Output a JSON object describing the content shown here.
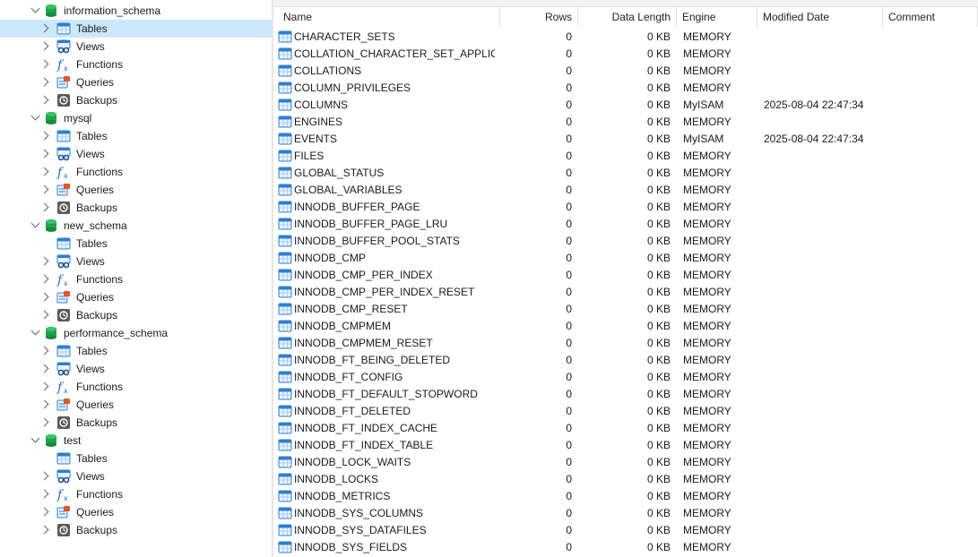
{
  "tree": {
    "schemas": [
      {
        "name": "information_schema",
        "items": [
          "Tables",
          "Views",
          "Functions",
          "Queries",
          "Backups"
        ]
      },
      {
        "name": "mysql",
        "items": [
          "Tables",
          "Views",
          "Functions",
          "Queries",
          "Backups"
        ]
      },
      {
        "name": "new_schema",
        "items": [
          "Tables",
          "Views",
          "Functions",
          "Queries",
          "Backups"
        ]
      },
      {
        "name": "performance_schema",
        "items": [
          "Tables",
          "Views",
          "Functions",
          "Queries",
          "Backups"
        ]
      },
      {
        "name": "test",
        "items": [
          "Tables",
          "Views",
          "Functions",
          "Queries",
          "Backups"
        ]
      }
    ],
    "selected": "information_schema/Tables"
  },
  "table": {
    "columns": [
      "Name",
      "Rows",
      "Data Length",
      "Engine",
      "Modified Date",
      "Comment"
    ],
    "rows": [
      [
        "CHARACTER_SETS",
        "0",
        "0 KB",
        "MEMORY",
        "",
        ""
      ],
      [
        "COLLATION_CHARACTER_SET_APPLICA...",
        "0",
        "0 KB",
        "MEMORY",
        "",
        ""
      ],
      [
        "COLLATIONS",
        "0",
        "0 KB",
        "MEMORY",
        "",
        ""
      ],
      [
        "COLUMN_PRIVILEGES",
        "0",
        "0 KB",
        "MEMORY",
        "",
        ""
      ],
      [
        "COLUMNS",
        "0",
        "0 KB",
        "MyISAM",
        "2025-08-04 22:47:34",
        ""
      ],
      [
        "ENGINES",
        "0",
        "0 KB",
        "MEMORY",
        "",
        ""
      ],
      [
        "EVENTS",
        "0",
        "0 KB",
        "MyISAM",
        "2025-08-04 22:47:34",
        ""
      ],
      [
        "FILES",
        "0",
        "0 KB",
        "MEMORY",
        "",
        ""
      ],
      [
        "GLOBAL_STATUS",
        "0",
        "0 KB",
        "MEMORY",
        "",
        ""
      ],
      [
        "GLOBAL_VARIABLES",
        "0",
        "0 KB",
        "MEMORY",
        "",
        ""
      ],
      [
        "INNODB_BUFFER_PAGE",
        "0",
        "0 KB",
        "MEMORY",
        "",
        ""
      ],
      [
        "INNODB_BUFFER_PAGE_LRU",
        "0",
        "0 KB",
        "MEMORY",
        "",
        ""
      ],
      [
        "INNODB_BUFFER_POOL_STATS",
        "0",
        "0 KB",
        "MEMORY",
        "",
        ""
      ],
      [
        "INNODB_CMP",
        "0",
        "0 KB",
        "MEMORY",
        "",
        ""
      ],
      [
        "INNODB_CMP_PER_INDEX",
        "0",
        "0 KB",
        "MEMORY",
        "",
        ""
      ],
      [
        "INNODB_CMP_PER_INDEX_RESET",
        "0",
        "0 KB",
        "MEMORY",
        "",
        ""
      ],
      [
        "INNODB_CMP_RESET",
        "0",
        "0 KB",
        "MEMORY",
        "",
        ""
      ],
      [
        "INNODB_CMPMEM",
        "0",
        "0 KB",
        "MEMORY",
        "",
        ""
      ],
      [
        "INNODB_CMPMEM_RESET",
        "0",
        "0 KB",
        "MEMORY",
        "",
        ""
      ],
      [
        "INNODB_FT_BEING_DELETED",
        "0",
        "0 KB",
        "MEMORY",
        "",
        ""
      ],
      [
        "INNODB_FT_CONFIG",
        "0",
        "0 KB",
        "MEMORY",
        "",
        ""
      ],
      [
        "INNODB_FT_DEFAULT_STOPWORD",
        "0",
        "0 KB",
        "MEMORY",
        "",
        ""
      ],
      [
        "INNODB_FT_DELETED",
        "0",
        "0 KB",
        "MEMORY",
        "",
        ""
      ],
      [
        "INNODB_FT_INDEX_CACHE",
        "0",
        "0 KB",
        "MEMORY",
        "",
        ""
      ],
      [
        "INNODB_FT_INDEX_TABLE",
        "0",
        "0 KB",
        "MEMORY",
        "",
        ""
      ],
      [
        "INNODB_LOCK_WAITS",
        "0",
        "0 KB",
        "MEMORY",
        "",
        ""
      ],
      [
        "INNODB_LOCKS",
        "0",
        "0 KB",
        "MEMORY",
        "",
        ""
      ],
      [
        "INNODB_METRICS",
        "0",
        "0 KB",
        "MEMORY",
        "",
        ""
      ],
      [
        "INNODB_SYS_COLUMNS",
        "0",
        "0 KB",
        "MEMORY",
        "",
        ""
      ],
      [
        "INNODB_SYS_DATAFILES",
        "0",
        "0 KB",
        "MEMORY",
        "",
        ""
      ],
      [
        "INNODB_SYS_FIELDS",
        "0",
        "0 KB",
        "MEMORY",
        "",
        ""
      ]
    ]
  },
  "colors": {
    "selection": "#cce8ff",
    "db_icon": "#1fa34a",
    "table_icon": "#2a7fd4",
    "function_icon": "#1f6fc9",
    "query_icon": "#e5532a"
  }
}
